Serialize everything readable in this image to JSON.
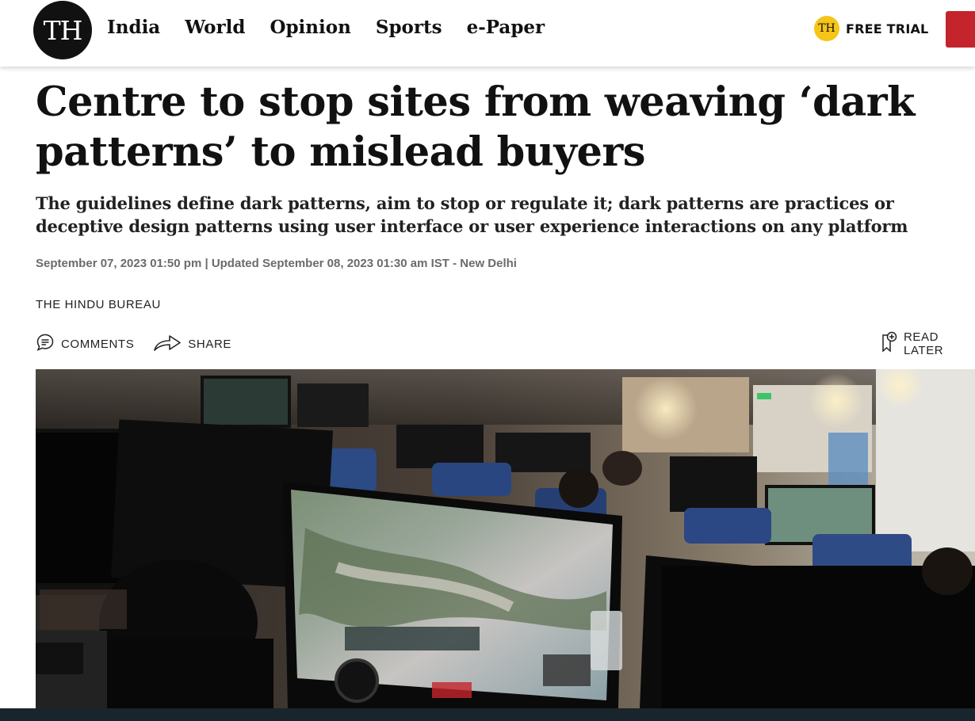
{
  "header": {
    "logo_text": "TH",
    "nav": [
      {
        "label": "India"
      },
      {
        "label": "World"
      },
      {
        "label": "Opinion"
      },
      {
        "label": "Sports"
      },
      {
        "label": "e-Paper"
      }
    ],
    "free_trial": {
      "badge": "TH",
      "label": "FREE TRIAL"
    }
  },
  "article": {
    "headline": "Centre to stop sites from weaving ‘dark patterns’ to mislead buyers",
    "standfirst": "The guidelines define dark patterns, aim to stop or regulate it; dark patterns are practices or deceptive design patterns using user interface or user experience interactions on any platform",
    "dateline": "September 07, 2023 01:50 pm | Updated September 08, 2023 01:30 am IST - New Delhi",
    "byline": "THE HINDU BUREAU",
    "actions": {
      "comments": "COMMENTS",
      "share": "SHARE",
      "read_later": "READ LATER"
    }
  },
  "colors": {
    "brand_red": "#c4242b",
    "badge_yellow": "#f5c518",
    "text_dark": "#111111",
    "meta_grey": "#6b6b6b"
  },
  "icons": [
    "comment-icon",
    "share-icon",
    "bookmark-add-icon"
  ]
}
